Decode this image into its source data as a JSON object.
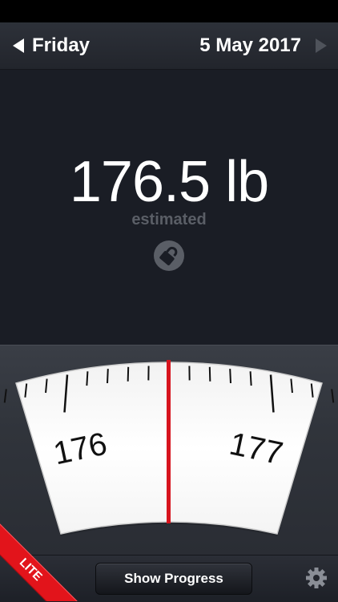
{
  "nav": {
    "day": "Friday",
    "date": "5 May 2017"
  },
  "reading": {
    "weight": "176.5 lb",
    "status": "estimated"
  },
  "scale": {
    "labels": [
      "176",
      "177"
    ],
    "value": 176.5
  },
  "footer": {
    "progress_label": "Show Progress"
  },
  "badge": {
    "label": "LITE"
  },
  "colors": {
    "needle": "#d7141e",
    "ribbon": "#e2141b",
    "background": "#1b1e26"
  },
  "icons": {
    "lock": "lock-open-icon",
    "settings": "gear-icon",
    "prev": "triangle-left-icon",
    "next": "triangle-right-icon"
  }
}
